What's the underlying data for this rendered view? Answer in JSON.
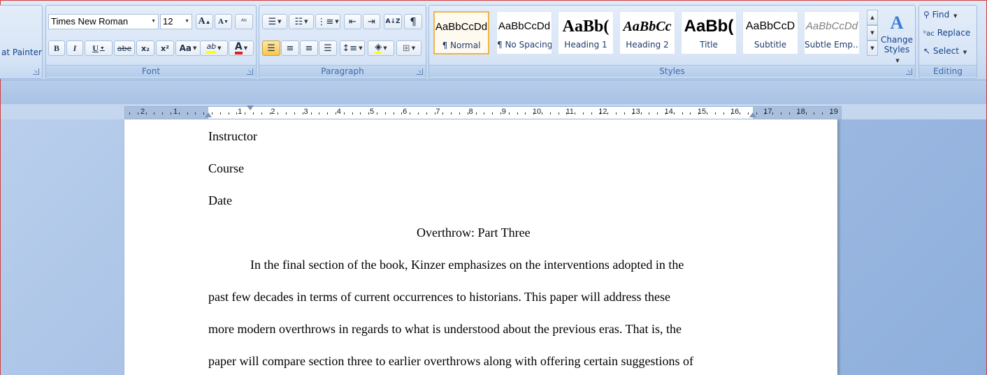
{
  "clipboard": {
    "format_painter_label": "at Painter"
  },
  "font": {
    "group_label": "Font",
    "font_name": "Times New Roman",
    "font_size": "12",
    "grow_label": "A",
    "shrink_label": "A",
    "clear_label": "ᴬᵇ",
    "bold_label": "B",
    "italic_label": "I",
    "underline_label": "U",
    "strike_label": "abe",
    "subscript_label": "x₂",
    "superscript_label": "x²",
    "case_label": "Aa",
    "highlight_label": "ab",
    "color_label": "A"
  },
  "paragraph": {
    "group_label": "Paragraph",
    "sort_label": "A↓Z",
    "pilcrow_label": "¶"
  },
  "styles": {
    "group_label": "Styles",
    "items": [
      {
        "preview": "AaBbCcDd",
        "name": "¶ Normal"
      },
      {
        "preview": "AaBbCcDd",
        "name": "¶ No Spacing"
      },
      {
        "preview": "AaBb(",
        "name": "Heading 1"
      },
      {
        "preview": "AaBbCc",
        "name": "Heading 2"
      },
      {
        "preview": "AaBb(",
        "name": "Title"
      },
      {
        "preview": "AaBbCcD",
        "name": "Subtitle"
      },
      {
        "preview": "AaBbCcDd",
        "name": "Subtle Emp..."
      }
    ],
    "change_styles_line1": "Change",
    "change_styles_line2": "Styles"
  },
  "editing": {
    "group_label": "Editing",
    "find_label": "Find",
    "replace_label": "Replace",
    "select_label": "Select"
  },
  "ruler": {
    "left_numbers": [
      "2",
      "1"
    ],
    "right_numbers": [
      "1",
      "2",
      "3",
      "4",
      "5",
      "6",
      "7",
      "8",
      "9",
      "10",
      "11",
      "12",
      "13",
      "14",
      "15",
      "16",
      "17",
      "18",
      "19"
    ]
  },
  "document": {
    "lines": [
      "Instructor",
      "Course",
      "Date",
      "Overthrow: Part Three",
      "In the final section of the book, Kinzer emphasizes on the interventions adopted in the",
      "past few decades in terms of current occurrences to historians. This paper will address these",
      "more modern overthrows in regards to what is understood about the previous eras. That is, the",
      "paper will compare section three to earlier overthrows along with offering certain suggestions of"
    ]
  },
  "colors": {
    "highlight": "#ffff00",
    "font_color": "#e02020",
    "selected_style_border": "#f0b44a"
  }
}
